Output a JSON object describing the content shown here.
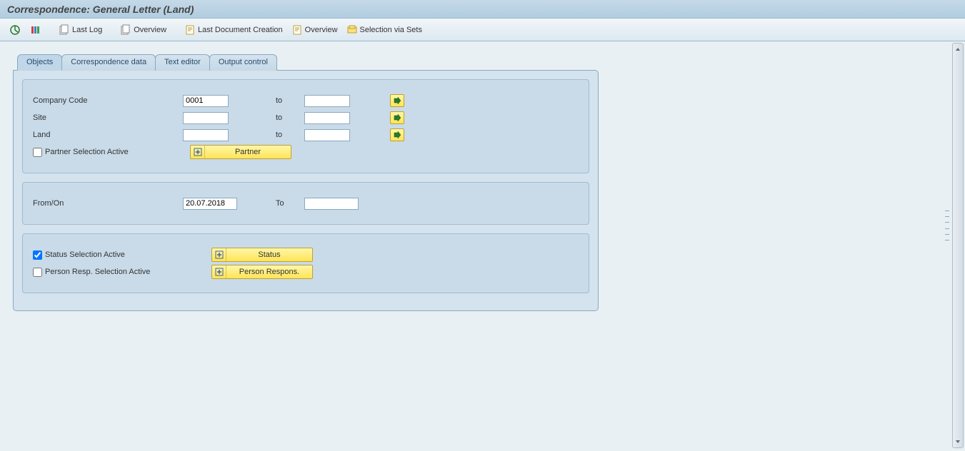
{
  "title": "Correspondence: General Letter (Land)",
  "toolbar": {
    "last_log": "Last Log",
    "overview1": "Overview",
    "last_doc": "Last Document Creation",
    "overview2": "Overview",
    "selection_sets": "Selection via Sets"
  },
  "tabs": {
    "objects": "Objects",
    "correspondence": "Correspondence data",
    "text_editor": "Text editor",
    "output_control": "Output control"
  },
  "group1": {
    "company_code_lbl": "Company Code",
    "company_code_val": "0001",
    "site_lbl": "Site",
    "site_val": "",
    "land_lbl": "Land",
    "land_val": "",
    "to_lbl": "to",
    "partner_sel_lbl": "Partner Selection Active",
    "partner_btn": "Partner"
  },
  "group2": {
    "from_on_lbl": "From/On",
    "from_on_val": "20.07.2018",
    "to_lbl": "To",
    "to_val": ""
  },
  "group3": {
    "status_sel_lbl": "Status Selection Active",
    "status_btn": "Status",
    "person_sel_lbl": "Person Resp. Selection Active",
    "person_btn": "Person Respons."
  }
}
